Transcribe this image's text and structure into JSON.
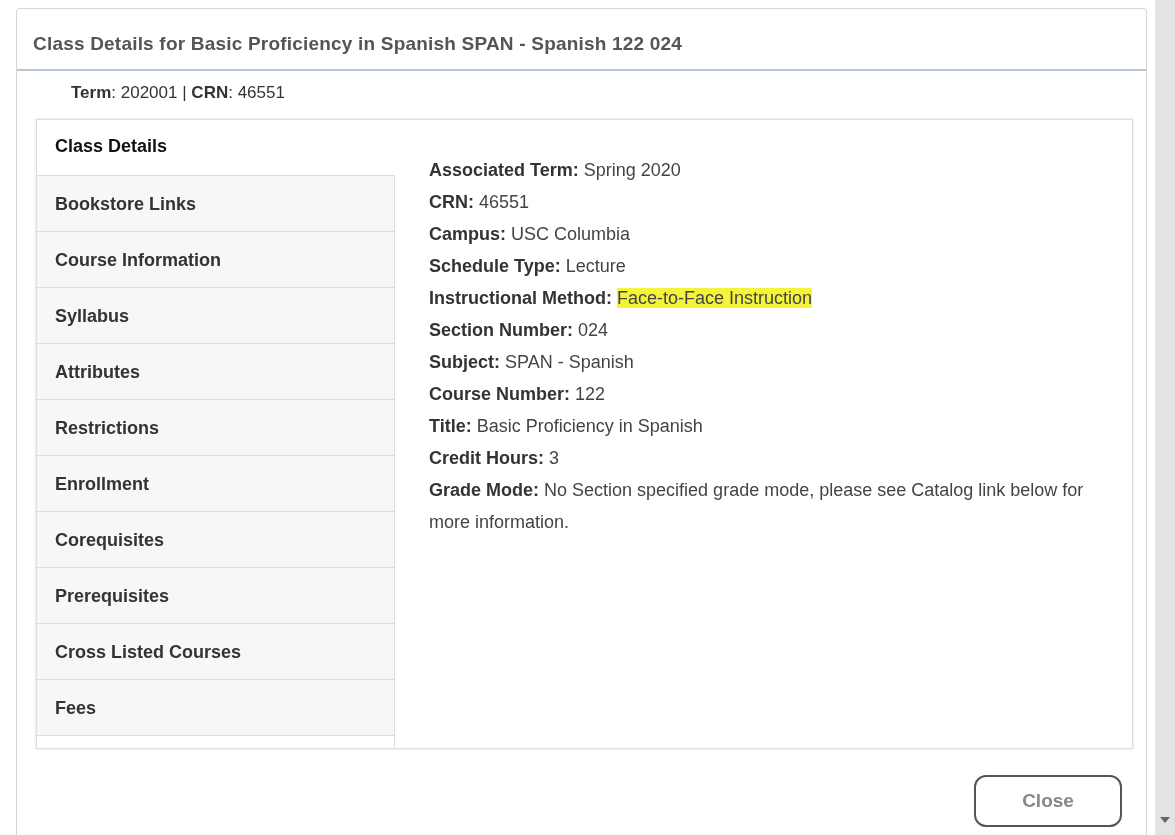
{
  "dialog": {
    "title": "Class Details for Basic Proficiency in Spanish SPAN - Spanish 122 024",
    "term_info": "**Term**: 202001 | **CRN**: 46551"
  },
  "sidebar": {
    "items": [
      {
        "label": "Class Details",
        "selected": true
      },
      {
        "label": "Bookstore Links",
        "selected": false
      },
      {
        "label": "Course Information",
        "selected": false
      },
      {
        "label": "Syllabus",
        "selected": false
      },
      {
        "label": "Attributes",
        "selected": false
      },
      {
        "label": "Restrictions",
        "selected": false
      },
      {
        "label": "Enrollment",
        "selected": false
      },
      {
        "label": "Corequisites",
        "selected": false
      },
      {
        "label": "Prerequisites",
        "selected": false
      },
      {
        "label": "Cross Listed Courses",
        "selected": false
      },
      {
        "label": "Fees",
        "selected": false
      }
    ]
  },
  "details": [
    {
      "label": "Associated Term:",
      "value": "Spring 2020",
      "highlighted": false
    },
    {
      "label": "CRN:",
      "value": "46551",
      "highlighted": false
    },
    {
      "label": "Campus:",
      "value": "USC Columbia",
      "highlighted": false
    },
    {
      "label": "Schedule Type:",
      "value": "Lecture",
      "highlighted": false
    },
    {
      "label": "Instructional Method:",
      "value": "Face-to-Face Instruction",
      "highlighted": true
    },
    {
      "label": "Section Number:",
      "value": "024",
      "highlighted": false
    },
    {
      "label": "Subject:",
      "value": "SPAN - Spanish",
      "highlighted": false
    },
    {
      "label": "Course Number:",
      "value": "122",
      "highlighted": false
    },
    {
      "label": "Title:",
      "value": "Basic Proficiency in Spanish",
      "highlighted": false
    },
    {
      "label": "Credit Hours:",
      "value": "3",
      "highlighted": false
    },
    {
      "label": "Grade Mode:",
      "value": "No Section specified grade mode, please see Catalog link below for more information.",
      "highlighted": false
    }
  ],
  "buttons": {
    "close": "Close"
  }
}
